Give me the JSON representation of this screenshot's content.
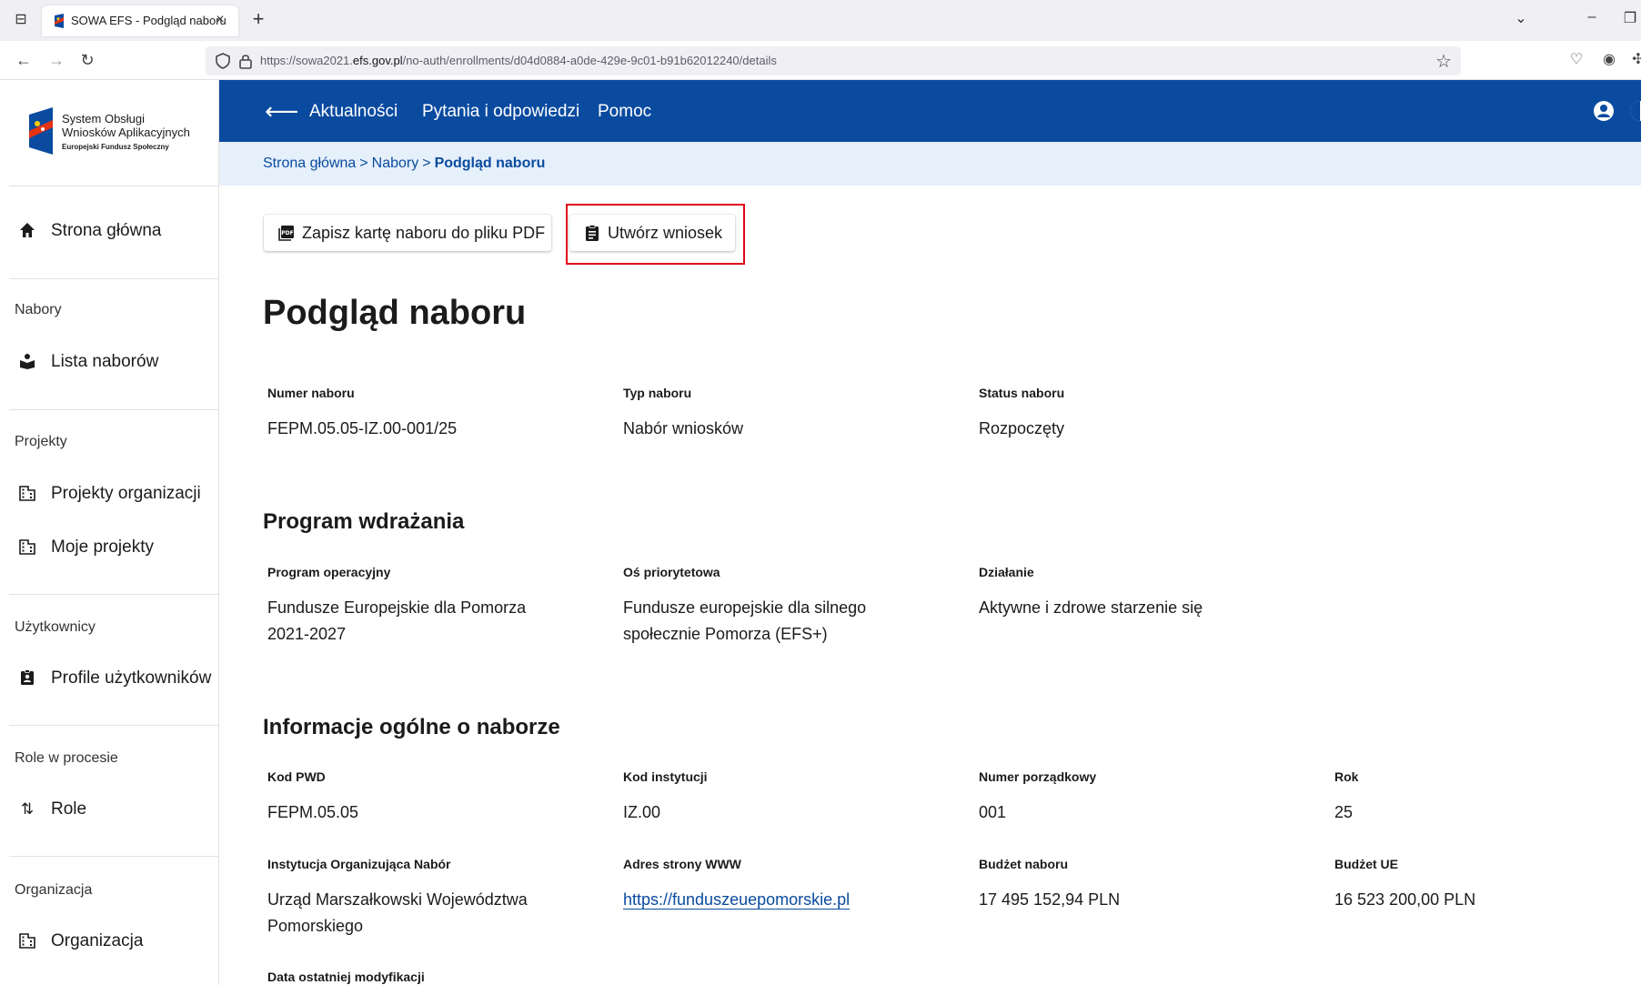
{
  "browser": {
    "tab_title": "SOWA EFS - Podgląd naboru",
    "url_prefix": "https://sowa2021.",
    "url_domain": "efs.gov.pl",
    "url_path": "/no-auth/enrollments/d04d0884-a0de-429e-9c01-b91b62012240/details"
  },
  "brand": {
    "line1": "System Obsługi",
    "line2": "Wniosków Aplikacyjnych",
    "line3": "Europejski Fundusz Społeczny"
  },
  "header": {
    "links": [
      "Aktualności",
      "Pytania i odpowiedzi",
      "Pomoc"
    ]
  },
  "breadcrumb": {
    "items": [
      "Strona główna",
      "Nabory"
    ],
    "separator": ">",
    "current": "Podgląd naboru"
  },
  "sidebar": {
    "home": "Strona główna",
    "sections": [
      {
        "title": "Nabory",
        "items": [
          "Lista naborów"
        ]
      },
      {
        "title": "Projekty",
        "items": [
          "Projekty organizacji",
          "Moje projekty"
        ]
      },
      {
        "title": "Użytkownicy",
        "items": [
          "Profile użytkowników"
        ]
      },
      {
        "title": "Role w procesie",
        "items": [
          "Role"
        ]
      },
      {
        "title": "Organizacja",
        "items": [
          "Organizacja"
        ]
      }
    ]
  },
  "toolbar": {
    "pdf_label": "Zapisz kartę naboru do pliku PDF",
    "create_label": "Utwórz wniosek"
  },
  "page": {
    "title": "Podgląd naboru",
    "basic": {
      "number_label": "Numer naboru",
      "number": "FEPM.05.05-IZ.00-001/25",
      "type_label": "Typ naboru",
      "type": "Nabór wniosków",
      "status_label": "Status naboru",
      "status": "Rozpoczęty"
    },
    "program": {
      "title": "Program wdrażania",
      "op_label": "Program operacyjny",
      "op": "Fundusze Europejskie dla Pomorza 2021-2027",
      "axis_label": "Oś priorytetowa",
      "axis": "Fundusze europejskie dla silnego społecznie Pomorza (EFS+)",
      "action_label": "Działanie",
      "action": "Aktywne i zdrowe starzenie się"
    },
    "general": {
      "title": "Informacje ogólne o naborze",
      "pwd_label": "Kod PWD",
      "pwd": "FEPM.05.05",
      "inst_code_label": "Kod instytucji",
      "inst_code": "IZ.00",
      "seq_label": "Numer porządkowy",
      "seq": "001",
      "year_label": "Rok",
      "year": "25",
      "org_label": "Instytucja Organizująca Nabór",
      "org": "Urząd Marszałkowski Województwa Pomorskiego",
      "www_label": "Adres strony WWW",
      "www": "https://funduszeuepomorskie.pl",
      "budget_label": "Budżet naboru",
      "budget": "17 495 152,94 PLN",
      "eu_budget_label": "Budżet UE",
      "eu_budget": "16 523 200,00 PLN",
      "modified_label": "Data ostatniej modyfikacji"
    }
  }
}
